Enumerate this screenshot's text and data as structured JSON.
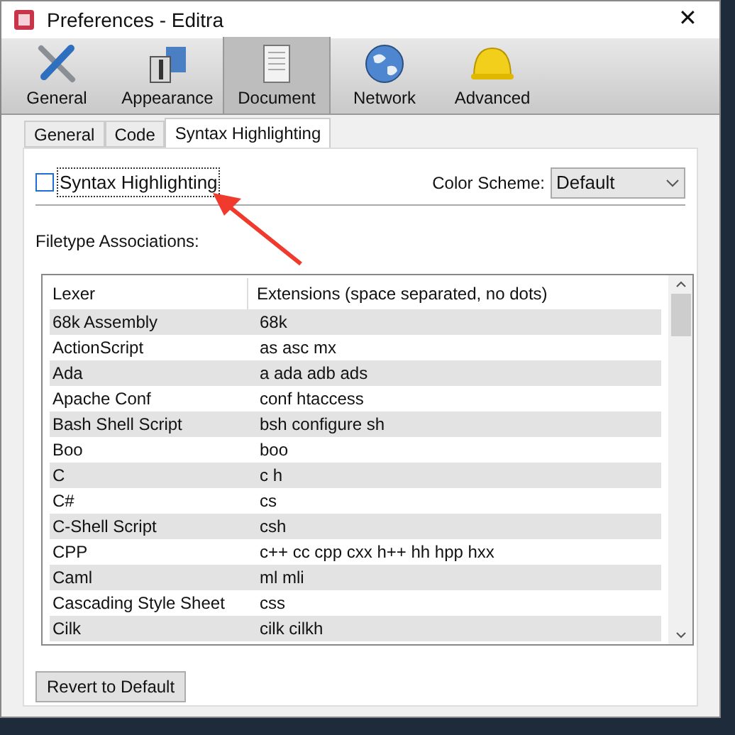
{
  "window": {
    "title": "Preferences - Editra",
    "close": "✕"
  },
  "toolbar": [
    {
      "label": "General",
      "selected": false
    },
    {
      "label": "Appearance",
      "selected": false
    },
    {
      "label": "Document",
      "selected": true
    },
    {
      "label": "Network",
      "selected": false
    },
    {
      "label": "Advanced",
      "selected": false
    }
  ],
  "subtabs": [
    {
      "label": "General",
      "selected": false
    },
    {
      "label": "Code",
      "selected": false
    },
    {
      "label": "Syntax Highlighting",
      "selected": true
    }
  ],
  "syntax_highlighting": {
    "label": "Syntax Highlighting",
    "checked": false
  },
  "color_scheme": {
    "label": "Color Scheme:",
    "value": "Default"
  },
  "filetype_label": "Filetype Associations:",
  "table": {
    "columns": [
      "Lexer",
      "Extensions (space separated, no dots)"
    ],
    "rows": [
      [
        "68k Assembly",
        "68k"
      ],
      [
        "ActionScript",
        "as asc mx"
      ],
      [
        "Ada",
        "a ada adb ads"
      ],
      [
        "Apache Conf",
        "conf htaccess"
      ],
      [
        "Bash Shell Script",
        "bsh configure sh"
      ],
      [
        "Boo",
        "boo"
      ],
      [
        "C",
        "c h"
      ],
      [
        "C#",
        "cs"
      ],
      [
        "C-Shell Script",
        "csh"
      ],
      [
        "CPP",
        "c++ cc cpp cxx h++ hh hpp hxx"
      ],
      [
        "Caml",
        "ml mli"
      ],
      [
        "Cascading Style Sheet",
        "css"
      ],
      [
        "Cilk",
        "cilk cilkh"
      ]
    ]
  },
  "revert_button": "Revert to Default"
}
